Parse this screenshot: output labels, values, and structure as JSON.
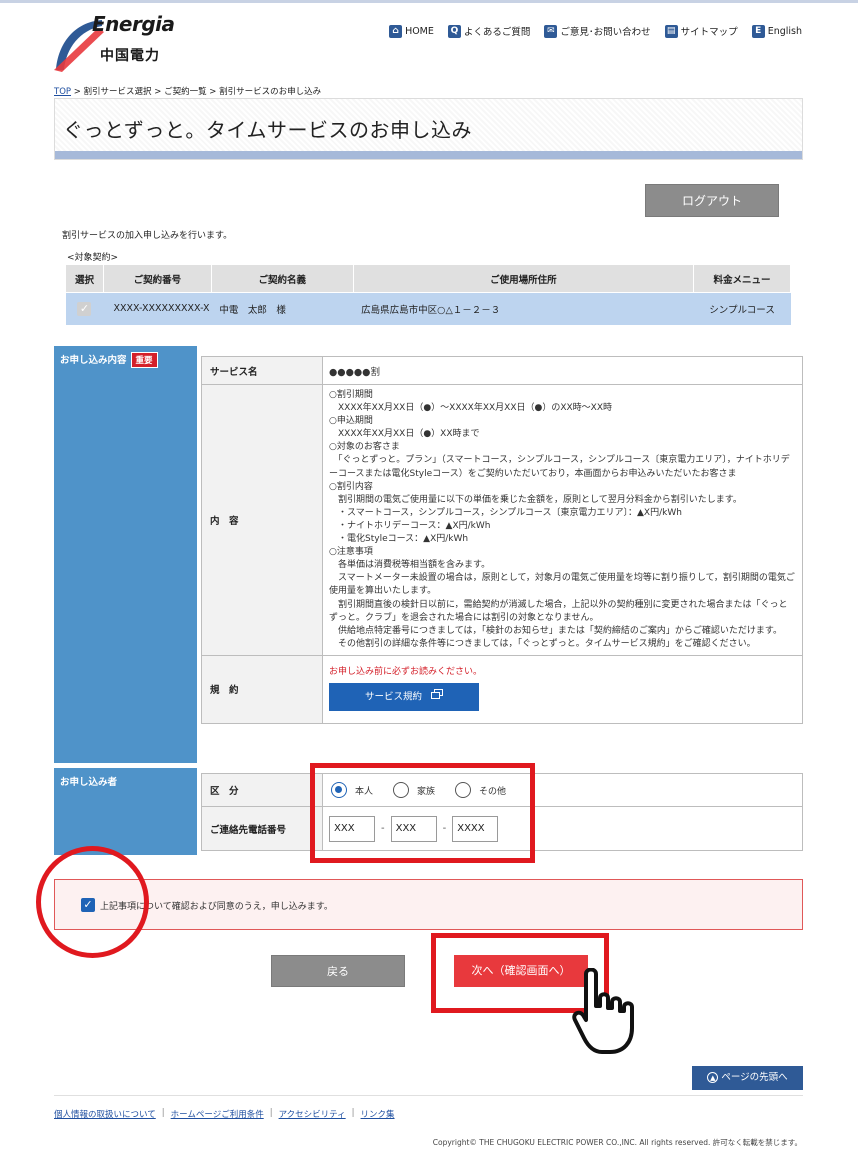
{
  "header": {
    "logo_word": "Energia",
    "logo_jp": "中国電力",
    "nav": [
      {
        "icon": "home-icon",
        "glyph": "⌂",
        "label": "HOME"
      },
      {
        "icon": "question-icon",
        "glyph": "Q",
        "label": "よくあるご質問"
      },
      {
        "icon": "mail-icon",
        "glyph": "✉",
        "label": "ご意見･お問い合わせ"
      },
      {
        "icon": "sitemap-icon",
        "glyph": "▤",
        "label": "サイトマップ"
      },
      {
        "icon": "english-icon",
        "glyph": "E",
        "label": "English"
      }
    ]
  },
  "breadcrumb": {
    "top": "TOP",
    "rest": " > 割引サービス選択 > ご契約一覧 > 割引サービスのお申し込み"
  },
  "page_title": "ぐっとずっと。タイムサービスのお申し込み",
  "logout_label": "ログアウト",
  "intro_text": "割引サービスの加入申し込みを行います。",
  "target_label": "<対象契約>",
  "contract_table": {
    "headers": [
      "選択",
      "ご契約番号",
      "ご契約名義",
      "ご使用場所住所",
      "料金メニュー"
    ],
    "row": {
      "number": "XXXX-XXXXXXXXX-X",
      "name": "中電　太郎　様",
      "address": "広島県広島市中区○△１－２－３",
      "menu": "シンプルコース"
    }
  },
  "application": {
    "side_label": "お申し込み内容",
    "badge": "重要",
    "service_name_label": "サービス名",
    "service_name_value": "●●●●●割",
    "content_label": "内　容",
    "content_lines": [
      "○割引期間",
      "　XXXX年XX月XX日（●）～XXXX年XX月XX日（●）のXX時～XX時",
      "○申込期間",
      "　XXXX年XX月XX日（●）XX時まで",
      "○対象のお客さま",
      "　「ぐっとずっと。プラン」（スマートコース，シンプルコース，シンプルコース〔東京電力エリア〕，ナイトホリデーコースまたは電化Styleコース）をご契約いただいており，本画面からお申込みいただいたお客さま",
      "○割引内容",
      "　割引期間の電気ご使用量に以下の単価を乗じた金額を，原則として翌月分料金から割引いたします。",
      "　・スマートコース，シンプルコース，シンプルコース〔東京電力エリア〕：▲X円/kWh",
      "　・ナイトホリデーコース：▲X円/kWh",
      "　・電化Styleコース：▲X円/kWh",
      "○注意事項",
      "　各単価は消費税等相当額を含みます。",
      "　スマートメーター未設置の場合は，原則として，対象月の電気ご使用量を均等に割り振りして，割引期間の電気ご使用量を算出いたします。",
      "　割引期間直後の検針日以前に，需給契約が消滅した場合，上記以外の契約種別に変更された場合または「ぐっとずっと。クラブ」を退会された場合には割引の対象となりません。",
      "　供給地点特定番号につきましては，「検針のお知らせ」または「契約締結のご案内」からご確認いただけます。",
      "　その他割引の詳細な条件等につきましては，「ぐっとずっと。タイムサービス規約」をご確認ください。"
    ],
    "terms_label": "規　約",
    "terms_notice": "お申し込み前に必ずお読みください。",
    "terms_button": "サービス規約"
  },
  "applicant": {
    "side_label": "お申し込み者",
    "category_label": "区　分",
    "options": [
      "本人",
      "家族",
      "その他"
    ],
    "selected": "本人",
    "phone_label": "ご連絡先電話番号",
    "phone": [
      "XXX",
      "XXX",
      "XXXX"
    ],
    "phone_sep": "-"
  },
  "agreement_text": "上記事項について確認および同意のうえ，申し込みます。",
  "back_button": "戻る",
  "next_button": "次へ（確認画面へ）",
  "pagetop_button": "ページの先頭へ",
  "footer": {
    "links": [
      "個人情報の取扱いについて",
      "ホームページご利用条件",
      "アクセシビリティ",
      "リンク集"
    ],
    "sep": "|",
    "copyright": "Copyright© THE CHUGOKU ELECTRIC POWER CO.,INC. All rights reserved.  許可なく転載を禁じます。"
  },
  "colors": {
    "accent_blue": "#1f63b6",
    "side_blue": "#4f93c9",
    "annotation_red": "#e0191f",
    "next_red": "#e8393d"
  }
}
